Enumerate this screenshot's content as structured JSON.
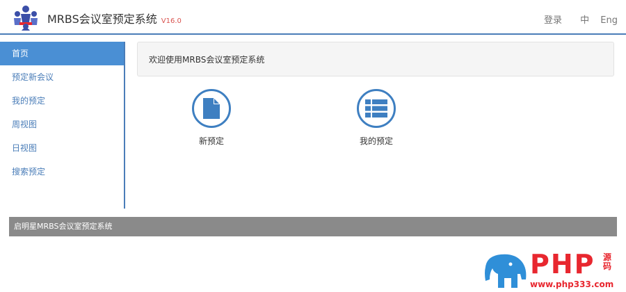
{
  "header": {
    "title": "MRBS会议室预定系统",
    "version": "V16.0",
    "login_label": "登录",
    "lang_zh": "中",
    "lang_en": "Eng"
  },
  "sidebar": {
    "items": [
      {
        "label": "首页",
        "active": true
      },
      {
        "label": "预定新会议",
        "active": false
      },
      {
        "label": "我的预定",
        "active": false
      },
      {
        "label": "周视图",
        "active": false
      },
      {
        "label": "日视图",
        "active": false
      },
      {
        "label": "搜索预定",
        "active": false
      }
    ]
  },
  "main": {
    "welcome": "欢迎使用MRBS会议室预定系统",
    "tiles": [
      {
        "label": "新预定",
        "icon": "file-icon"
      },
      {
        "label": "我的预定",
        "icon": "list-icon"
      }
    ]
  },
  "footer": {
    "text": "启明星MRBS会议室预定系统"
  },
  "watermark": {
    "brand": "PHP",
    "suffix": "源码",
    "url": "www.php333.com"
  },
  "colors": {
    "accent": "#4a7db8",
    "active_bg": "#4a8fd4",
    "icon": "#3e7fc1",
    "version": "#d9534f",
    "footer_bg": "#8a8a8a",
    "watermark": "#e8272f"
  }
}
